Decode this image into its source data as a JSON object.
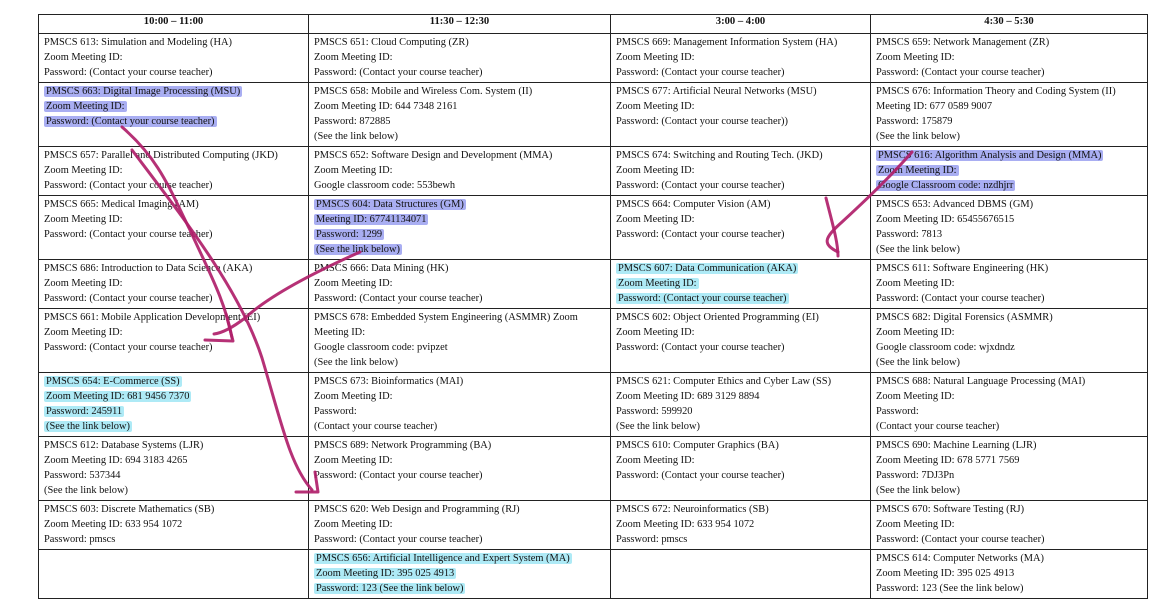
{
  "header": [
    "10:00 – 11:00",
    "11:30 – 12:30",
    "3:00 – 4:00",
    "4:30 – 5:30"
  ],
  "highlight_colors": {
    "purple": "#a9aef2",
    "cyan": "#aeeaf6",
    "ink": "#b0206a"
  },
  "rows": [
    [
      {
        "lines": [
          "PMSCS 613: Simulation and Modeling (HA)",
          "Zoom Meeting ID:",
          "Password: (Contact your course teacher)"
        ]
      },
      {
        "lines": [
          "PMSCS 651: Cloud Computing (ZR)",
          "Zoom Meeting ID:",
          "Password: (Contact your course teacher)"
        ]
      },
      {
        "lines": [
          "PMSCS 669: Management Information System (HA)",
          "Zoom Meeting ID:",
          "Password: (Contact your course teacher)"
        ]
      },
      {
        "lines": [
          "PMSCS 659: Network Management (ZR)",
          "Zoom Meeting ID:",
          "Password: (Contact your course teacher)"
        ]
      }
    ],
    [
      {
        "lines": [
          "PMSCS 663: Digital Image Processing (MSU)",
          "Zoom Meeting ID:",
          "Password: (Contact your course teacher)"
        ],
        "highlight": "purple"
      },
      {
        "lines": [
          "PMSCS 658: Mobile and Wireless Com. System (II)",
          "Zoom Meeting ID: 644 7348 2161",
          "Password: 872885",
          "(See the link below)"
        ]
      },
      {
        "lines": [
          "PMSCS 677: Artificial Neural Networks (MSU)",
          "Zoom Meeting ID:",
          "Password: (Contact your course teacher))"
        ]
      },
      {
        "lines": [
          "PMSCS 676: Information Theory and Coding System (II)",
          "Meeting ID: 677 0589 9007",
          "Password: 175879",
          "(See the link below)"
        ]
      }
    ],
    [
      {
        "lines": [
          "PMSCS 657: Parallel and Distributed Computing (JKD)",
          "Zoom Meeting ID:",
          "Password: (Contact your course teacher)"
        ]
      },
      {
        "lines": [
          "PMSCS 652: Software Design and Development (MMA)",
          "Zoom Meeting ID:",
          "Google classroom code: 553bewh"
        ]
      },
      {
        "lines": [
          "PMSCS 674: Switching and Routing Tech. (JKD)",
          "Zoom Meeting ID:",
          "Password: (Contact your course teacher)"
        ]
      },
      {
        "lines": [
          "PMSCS 616: Algorithm Analysis and Design (MMA)",
          "Zoom Meeting ID:",
          "Google Classroom code:  nzdhjrr"
        ],
        "highlight": "purple"
      }
    ],
    [
      {
        "lines": [
          "PMSCS 665: Medical Imaging (AM)",
          "Zoom Meeting ID:",
          "Password: (Contact your course teacher)"
        ]
      },
      {
        "lines": [
          "PMSCS 604: Data Structures (GM)",
          "Meeting ID: 67741134071",
          "Password: 1299",
          "(See the link below)"
        ],
        "highlight": "purple"
      },
      {
        "lines": [
          "PMSCS 664: Computer Vision (AM)",
          "Zoom Meeting ID:",
          "Password: (Contact your course teacher)"
        ]
      },
      {
        "lines": [
          "PMSCS 653: Advanced DBMS (GM)",
          "Zoom Meeting ID: 65455676515",
          "Password: 7813",
          "(See the link below)"
        ]
      }
    ],
    [
      {
        "lines": [
          "PMSCS 686: Introduction to Data Science (AKA)",
          "Zoom Meeting ID:",
          "Password: (Contact your course teacher)"
        ]
      },
      {
        "lines": [
          "PMSCS 666: Data Mining (HK)",
          "Zoom Meeting ID:",
          "Password: (Contact your course teacher)"
        ]
      },
      {
        "lines": [
          "PMSCS 607: Data Communication (AKA)",
          "Zoom Meeting ID:",
          "Password: (Contact your course teacher)"
        ],
        "highlight": "cyan"
      },
      {
        "lines": [
          "PMSCS 611: Software Engineering (HK)",
          "Zoom Meeting ID:",
          "Password: (Contact your course teacher)"
        ]
      }
    ],
    [
      {
        "lines": [
          "PMSCS 661: Mobile Application Development (EI)",
          "Zoom Meeting ID:",
          "Password: (Contact your course teacher)"
        ]
      },
      {
        "lines": [
          "PMSCS 678: Embedded System Engineering (ASMMR) Zoom",
          "Meeting ID:",
          "Google classroom code: pvipzet",
          "(See the link below)"
        ]
      },
      {
        "lines": [
          "PMSCS 602: Object Oriented Programming (EI)",
          "Zoom Meeting ID:",
          "Password: (Contact your course teacher)"
        ]
      },
      {
        "lines": [
          "PMSCS 682: Digital Forensics (ASMMR)",
          "Zoom Meeting ID:",
          "Google classroom code: wjxdndz",
          "(See the link below)"
        ]
      }
    ],
    [
      {
        "lines": [
          "PMSCS 654: E-Commerce (SS)",
          "Zoom Meeting ID: 681 9456 7370",
          "Password: 245911",
          "(See the link below)"
        ],
        "highlight": "cyan"
      },
      {
        "lines": [
          "PMSCS 673: Bioinformatics (MAI)",
          "Zoom Meeting ID:",
          "Password:",
          "(Contact your course teacher)"
        ]
      },
      {
        "lines": [
          "PMSCS 621: Computer Ethics and Cyber Law (SS)",
          "Zoom Meeting ID: 689 3129 8894",
          "Password: 599920",
          "(See the link below)"
        ]
      },
      {
        "lines": [
          "PMSCS 688: Natural Language Processing (MAI)",
          "Zoom Meeting ID:",
          "Password:",
          "(Contact your course teacher)"
        ]
      }
    ],
    [
      {
        "lines": [
          "PMSCS 612: Database Systems (LJR)",
          "Zoom Meeting ID: 694 3183 4265",
          "Password: 537344",
          "(See the link below)"
        ]
      },
      {
        "lines": [
          "PMSCS 689: Network Programming (BA)",
          "Zoom Meeting ID:",
          "Password: (Contact your course teacher)"
        ]
      },
      {
        "lines": [
          "PMSCS 610: Computer Graphics (BA)",
          "Zoom Meeting ID:",
          "Password: (Contact your course teacher)"
        ]
      },
      {
        "lines": [
          "PMSCS 690: Machine Learning (LJR)",
          "Zoom Meeting ID: 678 5771 7569",
          "Password: 7DJ3Pn",
          "(See the link below)"
        ]
      }
    ],
    [
      {
        "lines": [
          "PMSCS 603: Discrete Mathematics (SB)",
          "Zoom Meeting ID: 633 954 1072",
          "Password: pmscs"
        ]
      },
      {
        "lines": [
          "PMSCS 620: Web Design and Programming (RJ)",
          "Zoom Meeting ID:",
          "Password: (Contact your course teacher)"
        ]
      },
      {
        "lines": [
          "PMSCS 672: Neuroinformatics (SB)",
          "Zoom Meeting ID: 633 954 1072",
          "Password: pmscs"
        ]
      },
      {
        "lines": [
          "PMSCS 670: Software Testing (RJ)",
          "Zoom Meeting ID:",
          "Password: (Contact your course teacher)"
        ]
      }
    ],
    [
      {
        "lines": []
      },
      {
        "lines": [
          "PMSCS 656: Artificial Intelligence and Expert System (MA)",
          "Zoom Meeting ID: 395 025 4913",
          "Password: 123 (See the link below)"
        ],
        "highlight": "cyan"
      },
      {
        "lines": []
      },
      {
        "lines": [
          "PMSCS 614: Computer Networks (MA)",
          "Zoom Meeting ID: 395 025 4913",
          "Password: 123 (See the link below)"
        ]
      }
    ]
  ]
}
